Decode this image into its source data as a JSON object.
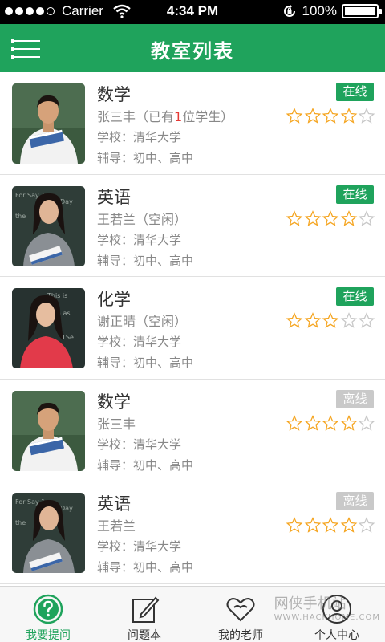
{
  "status_bar": {
    "carrier": "Carrier",
    "time": "4:34 PM",
    "battery": "100%"
  },
  "nav": {
    "title": "教室列表"
  },
  "rooms": [
    {
      "subject": "数学",
      "teacher": "张三丰",
      "status_text_prefix": "（已有",
      "student_count": "1",
      "status_text_suffix": "位学生）",
      "school": "学校：清华大学",
      "tutor": "辅导：初中、高中",
      "badge": "在线",
      "online": true,
      "rating": 4,
      "photo": "male-teacher"
    },
    {
      "subject": "英语",
      "teacher": "王若兰",
      "status_text": "（空闲）",
      "school": "学校：清华大学",
      "tutor": "辅导：初中、高中",
      "badge": "在线",
      "online": true,
      "rating": 4,
      "photo": "female-teacher"
    },
    {
      "subject": "化学",
      "teacher": "谢正晴",
      "status_text": "（空闲）",
      "school": "学校：清华大学",
      "tutor": "辅导：初中、高中",
      "badge": "在线",
      "online": true,
      "rating": 3,
      "photo": "female-teacher-red"
    },
    {
      "subject": "数学",
      "teacher": "张三丰",
      "status_text": "",
      "school": "学校：清华大学",
      "tutor": "辅导：初中、高中",
      "badge": "离线",
      "online": false,
      "rating": 4,
      "photo": "male-teacher"
    },
    {
      "subject": "英语",
      "teacher": "王若兰",
      "status_text": "",
      "school": "学校：清华大学",
      "tutor": "辅导：初中、高中",
      "badge": "离线",
      "online": false,
      "rating": 4,
      "photo": "female-teacher"
    }
  ],
  "tabs": [
    {
      "label": "我要提问",
      "icon": "question-icon",
      "active": true
    },
    {
      "label": "问题本",
      "icon": "notebook-icon",
      "active": false
    },
    {
      "label": "我的老师",
      "icon": "heart-icon",
      "active": false
    },
    {
      "label": "个人中心",
      "icon": "user-icon",
      "active": false
    }
  ],
  "watermark": {
    "text": "网侠手机站",
    "sub": "WWW.HACKHOME.COM"
  },
  "colors": {
    "brand": "#1fa35c",
    "offline": "#c9c9c9",
    "star": "#f5a623",
    "count": "#e53935"
  }
}
